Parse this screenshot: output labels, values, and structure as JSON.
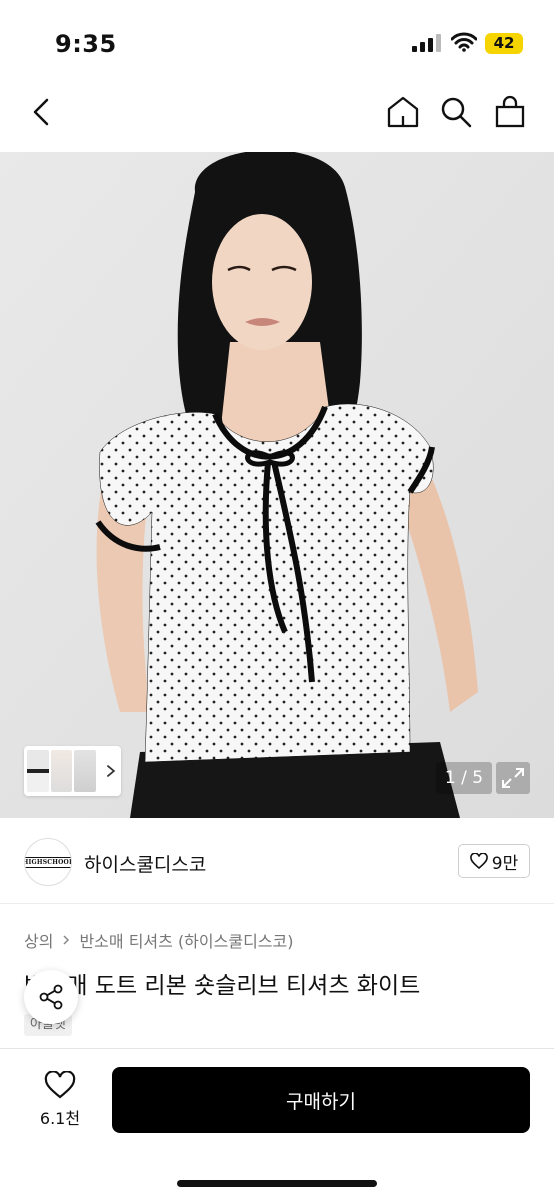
{
  "status_bar": {
    "time": "9:35",
    "battery": "42"
  },
  "nav": {
    "back_icon": "chevron-left-icon",
    "home_icon": "home-icon",
    "search_icon": "search-icon",
    "cart_icon": "shopping-bag-icon"
  },
  "gallery": {
    "counter": "1 / 5",
    "expand_icon": "expand-icon",
    "thumbnail_count": 3
  },
  "seller": {
    "name": "하이스쿨디스코",
    "logo_text": "HIGHSCHOOL",
    "likes": "9만"
  },
  "breadcrumb": {
    "category": "상의",
    "subcategory": "반소매 티셔츠 (하이스쿨디스코)"
  },
  "product": {
    "title": "반소매 도트 리본 숏슬리브 티셔츠 화이트",
    "tag": "아울렛"
  },
  "bottom": {
    "wish_count": "6.1천",
    "buy_label": "구매하기"
  },
  "colors": {
    "accent": "#000000",
    "battery": "#f5d400"
  }
}
